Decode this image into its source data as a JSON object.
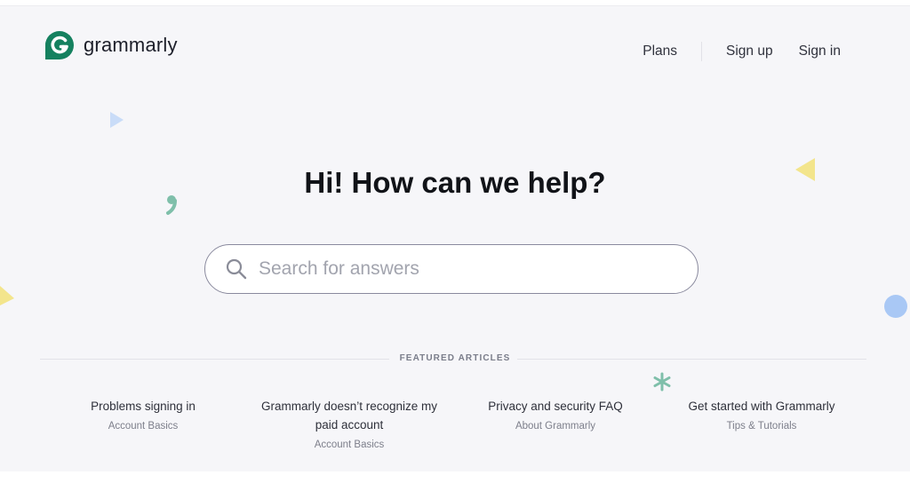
{
  "brand": {
    "name": "grammarly",
    "logo_letter": "G",
    "color": "#15815f"
  },
  "nav": {
    "plans": "Plans",
    "signup": "Sign up",
    "signin": "Sign in"
  },
  "hero": {
    "title": "Hi! How can we help?"
  },
  "search": {
    "placeholder": "Search for answers",
    "value": ""
  },
  "featured": {
    "label": "FEATURED ARTICLES",
    "articles": [
      {
        "title": "Problems signing in",
        "category": "Account Basics"
      },
      {
        "title": "Grammarly doesn’t recognize my paid account",
        "category": "Account Basics"
      },
      {
        "title": "Privacy and security FAQ",
        "category": "About Grammarly"
      },
      {
        "title": "Get started with Grammarly",
        "category": "Tips & Tutorials"
      }
    ]
  },
  "icons": [
    "grammarly-logo-icon",
    "search-icon",
    "triangle-icon",
    "comma-icon",
    "asterisk-icon",
    "circle-icon"
  ]
}
